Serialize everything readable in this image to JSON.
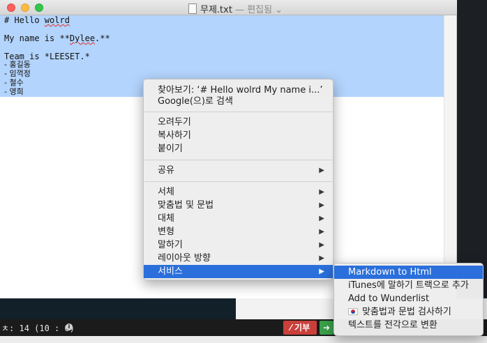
{
  "window": {
    "file_name": "무제.txt",
    "edit_status": "— 편집됨",
    "chevron": "⌄"
  },
  "document": {
    "lines": [
      {
        "pre": "# Hello ",
        "misspelled": "wolrd",
        "post": ""
      },
      {
        "pre": "",
        "misspelled": "",
        "post": ""
      },
      {
        "pre": "My name is **",
        "misspelled": "Dylee",
        "post": ".**"
      },
      {
        "pre": "",
        "misspelled": "",
        "post": ""
      },
      {
        "pre": "Team is *LEESET.*",
        "misspelled": "",
        "post": ""
      }
    ],
    "list_items": [
      "- 홍길동",
      "- 임꺽정",
      "- 철수",
      "- 영희"
    ]
  },
  "context_menu": {
    "look_up": "찾아보기: ‘# Hello wolrd  My name i...’",
    "search_google": "Google(으)로 검색",
    "cut": "오려두기",
    "copy": "복사하기",
    "paste": "붙이기",
    "share": "공유",
    "font": "서체",
    "spelling_grammar": "맞춤법 및 문법",
    "substitutions": "대체",
    "transformations": "변형",
    "speech": "말하기",
    "layout_orientation": "레이아웃 방향",
    "services": "서비스",
    "submenu_arrow": "▶"
  },
  "services_menu": {
    "items": [
      "Markdown to Html",
      "iTunes에 말하기 트랙으로 추가",
      "Add to Wunderlist",
      "맞춤법과 문법 검사하기",
      "텍스트를 전각으로 변환"
    ],
    "highlighted_index": 0
  },
  "status_bar": {
    "text": "ㅊ: 14  (10 : 0)",
    "info_glyph": "i",
    "donate_label": "기부",
    "share_glyph": "➜"
  },
  "colors": {
    "selection": "#b3d4fc",
    "menu_highlight": "#2a6fdb",
    "donate": "#c9403a",
    "share": "#3aa04a"
  }
}
